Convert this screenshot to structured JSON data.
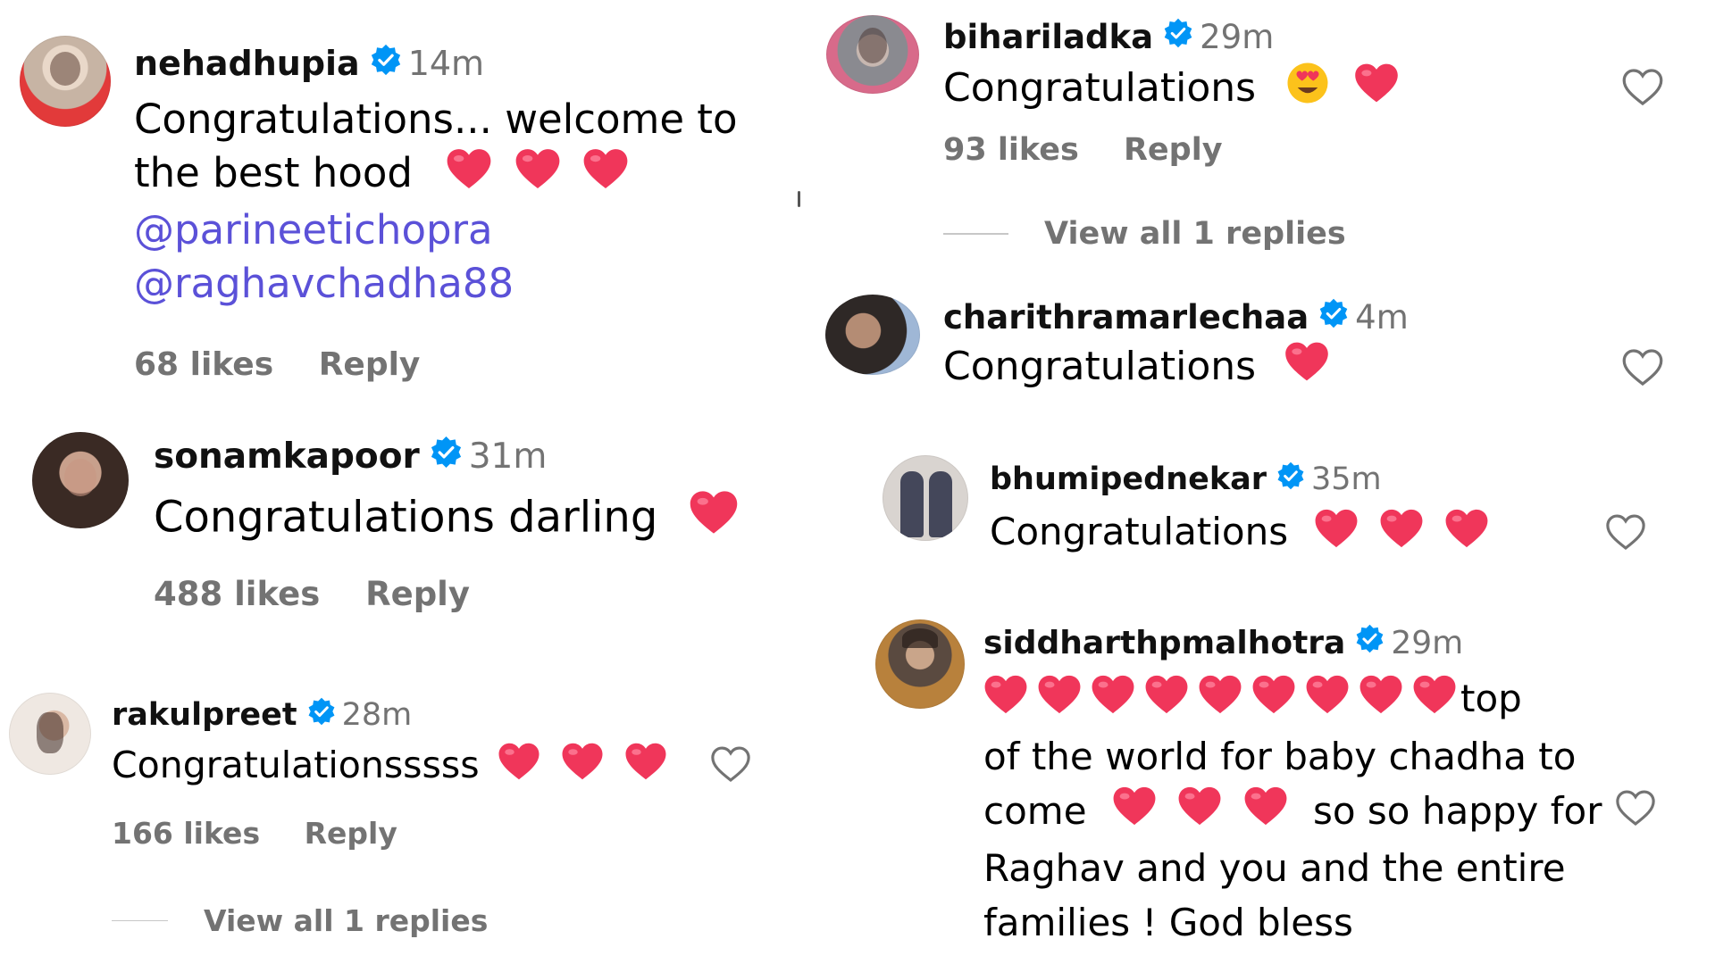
{
  "colors": {
    "mention": "#5b51d8",
    "muted": "#737373",
    "verified": "#0095f6",
    "heart": "#f0365a"
  },
  "icons": {
    "verified": "verified-badge-icon",
    "heart": "red-heart-emoji",
    "heart_eyes": "heart-eyes-emoji",
    "like": "heart-outline-icon"
  },
  "left": [
    {
      "username": "nehadhupia",
      "time": "14m",
      "lines": [
        "Congratulations... welcome to",
        "the best hood"
      ],
      "mentions": [
        "@parineetichopra",
        "@raghavchadha88"
      ],
      "likes": "68 likes",
      "reply": "Reply"
    },
    {
      "username": "sonamkapoor",
      "time": "31m",
      "text": "Congratulations darling",
      "likes": "488 likes",
      "reply": "Reply"
    },
    {
      "username": "rakulpreet",
      "time": "28m",
      "text": "Congratulationsssss",
      "likes": "166 likes",
      "reply": "Reply",
      "view_replies": "View all 1 replies"
    }
  ],
  "right": [
    {
      "username": "bihariladka",
      "time": "29m",
      "text": "Congratulations",
      "likes": "93 likes",
      "reply": "Reply",
      "view_replies": "View all 1 replies"
    },
    {
      "username": "charithramarlechaa",
      "time": "4m",
      "text": "Congratulations"
    },
    {
      "username": "bhumipednekar",
      "time": "35m",
      "text": "Congratulations"
    },
    {
      "username": "siddharthpmalhotra",
      "time": "29m",
      "lines": [
        "top",
        "of the world for baby chadha to",
        "come",
        "so so happy for",
        "Raghav and you and the entire",
        "families ! God bless"
      ]
    }
  ]
}
